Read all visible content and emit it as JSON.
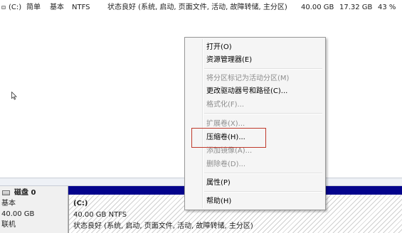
{
  "volume_row": {
    "volume": "(C:)",
    "layout": "简单",
    "type": "基本",
    "file_system": "NTFS",
    "status": "状态良好 (系统, 启动, 页面文件, 活动, 故障转储, 主分区)",
    "capacity": "40.00 GB",
    "free_space": "17.32 GB",
    "percent_free": "43 %"
  },
  "disk": {
    "name": "磁盘 0",
    "type": "基本",
    "size": "40.00 GB",
    "status": "联机"
  },
  "partition": {
    "name": "(C:)",
    "size_fs": "40.00 GB NTFS",
    "status": "状态良好 (系统, 启动, 页面文件, 活动, 故障转储, 主分区)",
    "bar_color": "#03038c"
  },
  "context_menu": {
    "open": "打开(O)",
    "explorer": "资源管理器(E)",
    "mark_active": "将分区标记为活动分区(M)",
    "change_letter": "更改驱动器号和路径(C)...",
    "format": "格式化(F)...",
    "extend": "扩展卷(X)...",
    "shrink": "压缩卷(H)...",
    "add_mirror": "添加镜像(A)...",
    "delete": "删除卷(D)...",
    "properties": "属性(P)",
    "help": "帮助(H)"
  },
  "highlight_color": "#c0392b"
}
